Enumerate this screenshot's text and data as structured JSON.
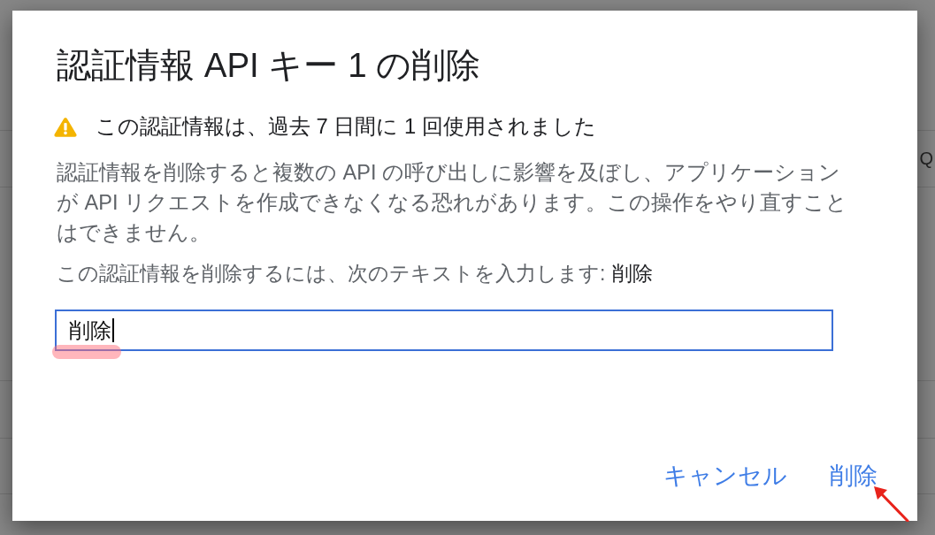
{
  "background": {
    "fragments": [
      "Q"
    ]
  },
  "dialog": {
    "title": "認証情報 API キー 1 の削除",
    "warning": {
      "kind": "warning",
      "text": "この認証情報は、過去 7 日間に 1 回使用されました"
    },
    "description": "認証情報を削除すると複数の API の呼び出しに影響を及ぼし、アプリケーションが API リクエストを作成できなくなる恐れがあります。この操作をやり直すことはできません。",
    "prompt": "この認証情報を削除するには、次のテキストを入力します:",
    "confirm_word": "削除",
    "input": {
      "value": "削除",
      "focused": true,
      "highlighted": true
    },
    "buttons": [
      {
        "label": "キャンセル",
        "arrow": false
      },
      {
        "label": "削除",
        "arrow": true
      }
    ]
  }
}
